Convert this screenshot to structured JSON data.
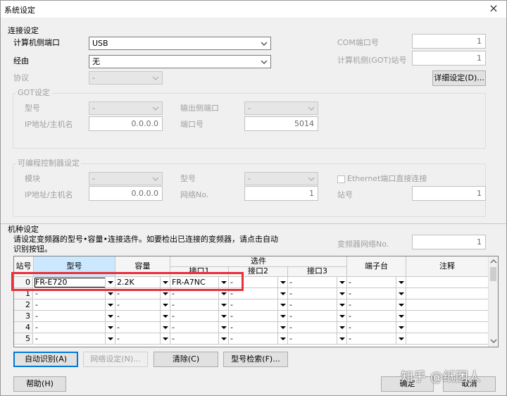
{
  "window": {
    "title": "系统设定",
    "close": "×"
  },
  "conn": {
    "heading": "连接设定",
    "port_label": "计算机侧端口",
    "port_value": "USB",
    "via_label": "经由",
    "via_value": "无",
    "protocol_label": "协议",
    "protocol_value": "-",
    "com_label": "COM端口号",
    "com_value": "1",
    "got_station_label": "计算机侧(GOT)站号",
    "got_station_value": "1",
    "detail_button": "详细设定(D)..."
  },
  "got": {
    "heading": "GOT设定",
    "model_label": "型号",
    "model_value": "-",
    "out_port_label": "输出侧端口",
    "out_port_value": "-",
    "ip_label": "IP地址/主机名",
    "ip_value": "0.0.0.0",
    "port_label": "端口号",
    "port_value": "5014"
  },
  "plc": {
    "heading": "可编程控制器设定",
    "module_label": "模块",
    "module_value": "-",
    "model_label": "型号",
    "model_value": "-",
    "eth_label": "Ethernet端口直接连接",
    "ip_label": "IP地址/主机名",
    "ip_value": "0.0.0.0",
    "network_label": "网络No.",
    "network_value": "1",
    "station_label": "站号",
    "station_value": "1"
  },
  "model": {
    "heading": "机种设定",
    "desc_line1": "请设定变频器的型号•容量•连接选件。如要检出已连接的变频器，请点击自动",
    "desc_line2": "识别按钮。",
    "inv_net_label": "变频器网络No.",
    "inv_net_value": "1"
  },
  "grid": {
    "headers": {
      "station": "站号",
      "model": "型号",
      "capacity": "容量",
      "options": "选件",
      "if1": "接口1",
      "if2": "接口2",
      "if3": "接口3",
      "terminal": "端子台",
      "note": "注释"
    },
    "rows": [
      {
        "no": "0",
        "model": "FR-E720",
        "capacity": "2.2K",
        "if1": "FR-A7NC",
        "if2": "-",
        "if3": "-",
        "terminal": "-",
        "note": ""
      },
      {
        "no": "1",
        "model": "-",
        "capacity": "-",
        "if1": "-",
        "if2": "-",
        "if3": "-",
        "terminal": "-",
        "note": ""
      },
      {
        "no": "2",
        "model": "-",
        "capacity": "-",
        "if1": "-",
        "if2": "-",
        "if3": "-",
        "terminal": "-",
        "note": ""
      },
      {
        "no": "3",
        "model": "-",
        "capacity": "-",
        "if1": "-",
        "if2": "-",
        "if3": "-",
        "terminal": "-",
        "note": ""
      },
      {
        "no": "4",
        "model": "-",
        "capacity": "-",
        "if1": "-",
        "if2": "-",
        "if3": "-",
        "terminal": "-",
        "note": ""
      },
      {
        "no": "5",
        "model": "-",
        "capacity": "-",
        "if1": "-",
        "if2": "-",
        "if3": "-",
        "terminal": "-",
        "note": ""
      }
    ]
  },
  "buttons": {
    "auto": "自动识别(A)",
    "network": "网络设定(N)...",
    "clear": "清除(C)",
    "search": "型号检索(F)...",
    "help": "帮助(H)",
    "ok": "确定",
    "cancel": "取消"
  },
  "watermark": "知乎 @纸团人"
}
